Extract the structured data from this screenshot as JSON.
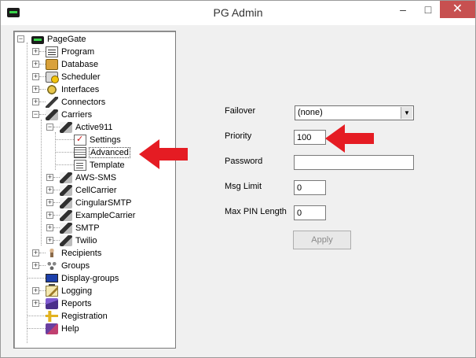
{
  "window": {
    "title": "PG Admin"
  },
  "titlebar": {
    "minimize": "–",
    "maximize": "□",
    "close": "✕"
  },
  "tree": {
    "root": "PageGate",
    "items": [
      {
        "label": "Program",
        "icon": "document-icon"
      },
      {
        "label": "Database",
        "icon": "database-icon"
      },
      {
        "label": "Scheduler",
        "icon": "clock-icon"
      },
      {
        "label": "Interfaces",
        "icon": "interfaces-icon"
      },
      {
        "label": "Connectors",
        "icon": "connectors-icon"
      },
      {
        "label": "Carriers",
        "icon": "satellite-icon"
      }
    ],
    "carrier": {
      "label": "Active911"
    },
    "carrier_children": [
      "Settings",
      "Advanced",
      "Template"
    ],
    "other_carriers": [
      "AWS-SMS",
      "CellCarrier",
      "CingularSMTP",
      "ExampleCarrier",
      "SMTP",
      "Twilio"
    ],
    "bottom_items": [
      {
        "label": "Recipients",
        "icon": "person-icon"
      },
      {
        "label": "Groups",
        "icon": "group-icon"
      },
      {
        "label": "Display-groups",
        "icon": "monitor-icon"
      },
      {
        "label": "Logging",
        "icon": "log-icon"
      },
      {
        "label": "Reports",
        "icon": "report-icon"
      },
      {
        "label": "Registration",
        "icon": "key-icon"
      },
      {
        "label": "Help",
        "icon": "help-book-icon"
      }
    ],
    "expander_collapsed": "+",
    "expander_expanded": "−"
  },
  "form": {
    "failover_label": "Failover",
    "failover_value": "(none)",
    "priority_label": "Priority",
    "priority_value": "100",
    "password_label": "Password",
    "password_value": "",
    "msg_limit_label": "Msg Limit",
    "msg_limit_value": "0",
    "max_pin_label": "Max PIN Length",
    "max_pin_value": "0",
    "apply_label": "Apply"
  },
  "colors": {
    "arrow": "#e51c23",
    "selection_border": "#444444"
  }
}
